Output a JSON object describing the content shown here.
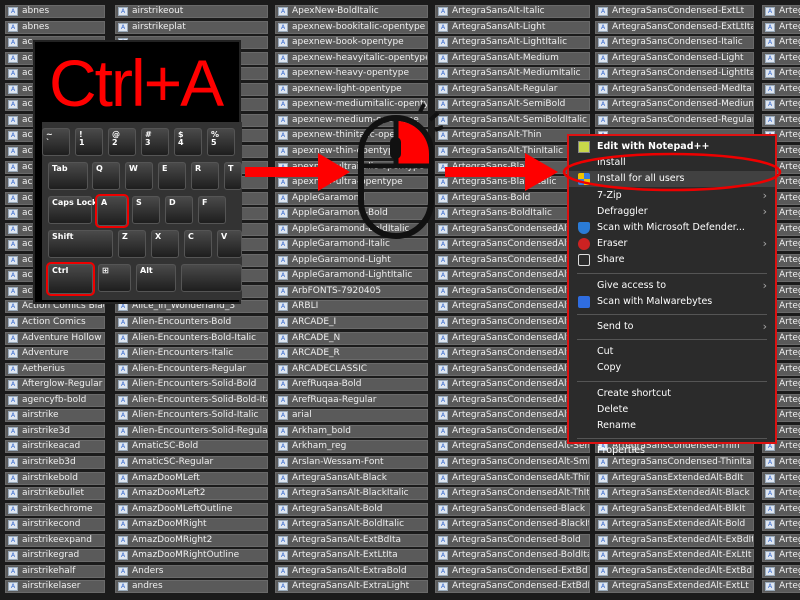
{
  "columns": [
    [
      "abnes",
      "abnes",
      "ac",
      "ac",
      "ac",
      "ac",
      "ac",
      "ac",
      "ac",
      "ac",
      "ac",
      "ac",
      "ac",
      "ac",
      "ac",
      "ac",
      "ac",
      "ac",
      "ac",
      "Action Comics Black",
      "Action Comics",
      "Adventure Hollow",
      "Adventure",
      "Aetherius",
      "Afterglow-Regular",
      "agencyfb-bold",
      "airstrike",
      "airstrike3d",
      "airstrikeacad",
      "airstrikeb3d",
      "airstrikebold",
      "airstrikebullet",
      "airstrikechrome",
      "airstrikecond",
      "airstrikeexpand",
      "airstrikegrad",
      "airstrikehalf",
      "airstrikelaser"
    ],
    [
      "airstrikeout",
      "airstrikeplat",
      "",
      "",
      "",
      "",
      "",
      "",
      "",
      "",
      "",
      "",
      "",
      "",
      "",
      "",
      "",
      "",
      "",
      "Alice_in_Wonderland_3",
      "Alien-Encounters-Bold",
      "Alien-Encounters-Bold-Italic",
      "Alien-Encounters-Italic",
      "Alien-Encounters-Regular",
      "Alien-Encounters-Solid-Bold",
      "Alien-Encounters-Solid-Bold-Italic",
      "Alien-Encounters-Solid-Italic",
      "Alien-Encounters-Solid-Regular",
      "AmaticSC-Bold",
      "AmaticSC-Regular",
      "AmazDooMLeft",
      "AmazDooMLeft2",
      "AmazDooMLeftOutline",
      "AmazDooMRight",
      "AmazDooMRight2",
      "AmazDooMRightOutline",
      "Anders",
      "andres"
    ],
    [
      "ApexNew-BoldItalic",
      "apexnew-bookitalic-opentype",
      "apexnew-book-opentype",
      "apexnew-heavyitalic-opentype",
      "apexnew-heavy-opentype",
      "apexnew-light-opentype",
      "apexnew-mediumitalic-opentype",
      "apexnew-medium-opentype",
      "apexnew-thinitalic-opentype",
      "apexnew-thin-opentype",
      "apexnew-ultraitalic-opentype",
      "apexnew-ultra-opentype",
      "AppleGaramond",
      "AppleGaramond-Bold",
      "AppleGaramond-BoldItalic",
      "AppleGaramond-Italic",
      "AppleGaramond-Light",
      "AppleGaramond-LightItalic",
      "ArbFONTS-7920405",
      "ARBLI",
      "ARCADE_I",
      "ARCADE_N",
      "ARCADE_R",
      "ARCADECLASSIC",
      "ArefRuqaa-Bold",
      "ArefRuqaa-Regular",
      "arial",
      "Arkham_bold",
      "Arkham_reg",
      "Arslan-Wessam-Font",
      "ArtegraSansAlt-Black",
      "ArtegraSansAlt-BlackItalic",
      "ArtegraSansAlt-Bold",
      "ArtegraSansAlt-BoldItalic",
      "ArtegraSansAlt-ExtBdIta",
      "ArtegraSansAlt-ExtLtIta",
      "ArtegraSansAlt-ExtraBold",
      "ArtegraSansAlt-ExtraLight"
    ],
    [
      "ArtegraSansAlt-Italic",
      "ArtegraSansAlt-Light",
      "ArtegraSansAlt-LightItalic",
      "ArtegraSansAlt-Medium",
      "ArtegraSansAlt-MediumItalic",
      "ArtegraSansAlt-Regular",
      "ArtegraSansAlt-SemiBold",
      "ArtegraSansAlt-SemiBoldItalic",
      "ArtegraSansAlt-Thin",
      "ArtegraSansAlt-ThinItalic",
      "ArtegraSans-Black",
      "ArtegraSans-BlackItalic",
      "ArtegraSans-Bold",
      "ArtegraSans-BoldItalic",
      "ArtegraSansCondensedAlt-BdI",
      "ArtegraSansCondensedAlt-Bla",
      "ArtegraSansCondensedAlt-Blk",
      "ArtegraSansCondensedAlt-Bol",
      "ArtegraSansCondensedAlt-ExB",
      "ArtegraSansCondensedAlt-ExL",
      "ArtegraSansCondensedAlt-Ext",
      "ArtegraSansCondensedAlt-Ext",
      "ArtegraSansCondensedAlt-Ita",
      "ArtegraSansCondensedAlt-Lig",
      "ArtegraSansCondensedAlt-Ltlt",
      "ArtegraSansCondensedAlt-Md",
      "ArtegraSansCondensedAlt-Me",
      "ArtegraSansCondensedAlt-Reg",
      "ArtegraSansCondensedAlt-SemBd",
      "ArtegraSansCondensedAlt-SmIt",
      "ArtegraSansCondensedAlt-Thin",
      "ArtegraSansCondensedAlt-ThIt",
      "ArtegraSansCondensed-Black",
      "ArtegraSansCondensed-BlackIta",
      "ArtegraSansCondensed-Bold",
      "ArtegraSansCondensed-BoldIta",
      "ArtegraSansCondensed-ExtBd",
      "ArtegraSansCondensed-ExtBdIta"
    ],
    [
      "ArtegraSansCondensed-ExtLt",
      "ArtegraSansCondensed-ExtLtIta",
      "ArtegraSansCondensed-Italic",
      "ArtegraSansCondensed-Light",
      "ArtegraSansCondensed-LightIta",
      "ArtegraSansCondensed-MedIta",
      "ArtegraSansCondensed-Medium",
      "ArtegraSansCondensed-Regular",
      "",
      "",
      "",
      "",
      "",
      "",
      "",
      "",
      "",
      "",
      "",
      "",
      "",
      "",
      "",
      "",
      "",
      "",
      "",
      "",
      "ArtegraSansCondensed-Thin",
      "ArtegraSansCondensed-ThinIta",
      "ArtegraSansExtendedAlt-BdIt",
      "ArtegraSansExtendedAlt-Black",
      "ArtegraSansExtendedAlt-BlkIt",
      "ArtegraSansExtendedAlt-Bold",
      "ArtegraSansExtendedAlt-ExBdIt",
      "ArtegraSansExtendedAlt-ExLtIt",
      "ArtegraSansExtendedAlt-ExtBd",
      "ArtegraSansExtendedAlt-ExtLt"
    ],
    [
      "Arteg",
      "Arteg",
      "Arteg",
      "Arteg",
      "Arteg",
      "Arteg",
      "Arteg",
      "Arteg",
      "Arteg",
      "Arteg",
      "Arteg",
      "Arteg",
      "Arteg",
      "Arteg",
      "Arteg",
      "Arteg",
      "Arteg",
      "Arteg",
      "Arteg",
      "Arteg",
      "Arteg",
      "Arteg",
      "Arteg",
      "Arteg",
      "Arteg",
      "Arteg",
      "Arteg",
      "Arteg",
      "Arteg",
      "Arteg",
      "Arteg",
      "Arteg",
      "Arteg",
      "Arteg",
      "Arteg",
      "Arteg",
      "Arteg",
      "Arteg"
    ]
  ],
  "shortcut": {
    "title": "Ctrl+A",
    "keys": [
      "~\n`",
      "!\n1",
      "@\n2",
      "#\n3",
      "$\n4",
      "%\n5",
      "Tab",
      "Q",
      "W",
      "E",
      "R",
      "T",
      "Caps Lock",
      "A",
      "S",
      "D",
      "F",
      "Shift",
      "Z",
      "X",
      "C",
      "V",
      "Ctrl",
      "⊞",
      "Alt"
    ]
  },
  "context_menu": {
    "items": [
      {
        "label": "Edit with Notepad++",
        "icon": "notepad-icon",
        "bold": true
      },
      {
        "label": "Install"
      },
      {
        "label": "Install for all users",
        "icon": "shield-uac-icon",
        "highlighted": true
      },
      {
        "label": "7-Zip",
        "submenu": true
      },
      {
        "label": "Defraggler",
        "submenu": true
      },
      {
        "label": "Scan with Microsoft Defender...",
        "icon": "defender-icon"
      },
      {
        "label": "Eraser",
        "icon": "eraser-icon",
        "submenu": true
      },
      {
        "label": "Share",
        "icon": "share-icon"
      },
      {
        "sep": true
      },
      {
        "label": "Give access to",
        "submenu": true
      },
      {
        "label": "Scan with Malwarebytes",
        "icon": "malwarebytes-icon"
      },
      {
        "sep": true
      },
      {
        "label": "Send to",
        "submenu": true
      },
      {
        "sep": true
      },
      {
        "label": "Cut"
      },
      {
        "label": "Copy"
      },
      {
        "sep": true
      },
      {
        "label": "Create shortcut"
      },
      {
        "label": "Delete"
      },
      {
        "label": "Rename"
      },
      {
        "sep": true
      },
      {
        "label": "Properties"
      }
    ]
  },
  "colors": {
    "annotation": "#ff0000",
    "item_bg": "#5a5a5a",
    "menu_bg": "#2b2b2b"
  }
}
